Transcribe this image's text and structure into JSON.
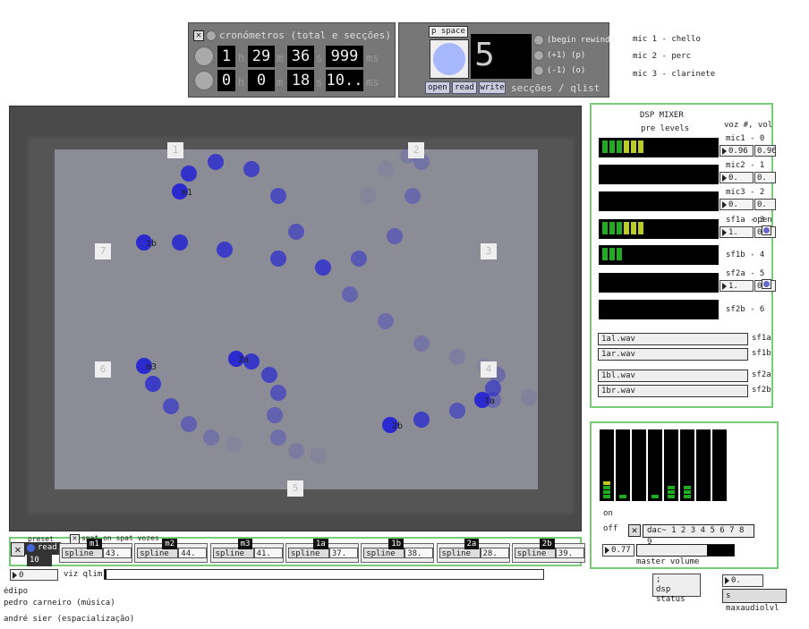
{
  "chrono": {
    "title": "cronómetros (total e secções)",
    "row1": {
      "h": "1",
      "m": "29",
      "s": "36",
      "ms": "999"
    },
    "row2": {
      "h": "0",
      "m": "0",
      "s": "18",
      "ms": "10.."
    },
    "units": {
      "h": "h",
      "m": "m",
      "s": "s",
      "ms": "ms"
    }
  },
  "qlist": {
    "space_msg": "p space",
    "number": "5",
    "begin_rewind": "(begin rewind)",
    "plus": "(+1) (p)",
    "minus": "(-1) (o)",
    "open": "open",
    "read": "read",
    "write": "write",
    "label": "secções / qlist"
  },
  "mics": {
    "mic1": "mic 1 - chello",
    "mic2": "mic 2 - perc",
    "mic3": "mic 3 - clarinete"
  },
  "mixer": {
    "title": "DSP MIXER",
    "subtitle": "pre levels",
    "header_right": "voz #, vol",
    "channels": [
      {
        "label": "mic1 - 0",
        "value": "0.96",
        "value2": "0.96",
        "level": 6
      },
      {
        "label": "mic2 - 1",
        "value": "0.",
        "value2": "0.",
        "level": 0
      },
      {
        "label": "mic3 - 2",
        "value": "0.",
        "value2": "0.",
        "level": 0
      },
      {
        "label": "sf1a - 3",
        "value": "1.",
        "value2": "0.5",
        "level": 6
      },
      {
        "label": "sf1b - 4",
        "level": 3
      },
      {
        "label": "sf2a - 5",
        "value": "1.",
        "value2": "0.5",
        "level": 0
      },
      {
        "label": "sf2b - 6",
        "level": 0
      }
    ],
    "open_label": "open",
    "files": [
      {
        "name": "1al.wav",
        "tag": "sf1a"
      },
      {
        "name": "1ar.wav",
        "tag": "sf1b"
      },
      {
        "name": "1bl.wav",
        "tag": "sf2a"
      },
      {
        "name": "1br.wav",
        "tag": "sf2b"
      }
    ]
  },
  "dac": {
    "on": "on",
    "off": "off",
    "object": "dac~ 1 2 3 4 5 6 7 8 9",
    "volume": "0.77",
    "volume_label": "master volume",
    "volume_fraction": 0.72,
    "meter_levels": [
      4,
      1,
      0,
      1,
      3,
      3,
      0,
      0
    ]
  },
  "spatial": {
    "nodes": [
      "1",
      "2",
      "3",
      "4",
      "5",
      "6",
      "7"
    ],
    "traces": [
      "m1",
      "1b",
      "m3",
      "2a",
      "2b",
      "1a"
    ]
  },
  "bottom": {
    "preset": "preset",
    "spat_label": "spat on  spat vozes",
    "read_btn": "read",
    "preset_num": "10",
    "splines": [
      {
        "tag": "m1",
        "value": "43."
      },
      {
        "tag": "m2",
        "value": "44."
      },
      {
        "tag": "m3",
        "value": "41."
      },
      {
        "tag": "1a",
        "value": "37."
      },
      {
        "tag": "1b",
        "value": "38."
      },
      {
        "tag": "2a",
        "value": "28."
      },
      {
        "tag": "2b",
        "value": "39."
      }
    ],
    "spline_label": "spline",
    "qlim_value": "0",
    "qlim_label": "viz qlim",
    "dsp_status": "dsp status",
    "maxaudio_value": "0.",
    "maxaudio_msg": "s maxaudiolvl"
  },
  "credits": {
    "title": "édipo",
    "line1": "pedro carneiro (música)",
    "line2": "andré sier (espacialização)"
  },
  "colors": {
    "accent_green": "#77cc77",
    "blob": "#2a2ad0",
    "meter_green": "#22aa22",
    "meter_yellow": "#bbcc22"
  }
}
